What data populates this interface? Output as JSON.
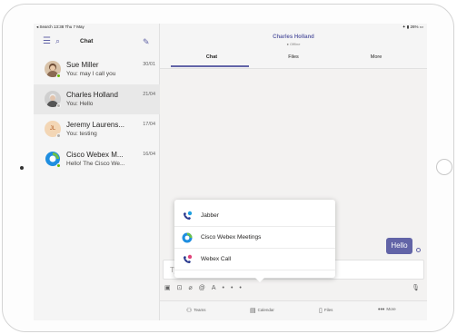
{
  "status_bar": {
    "left": "◂ Search  13:38  Thu 7 May",
    "right": "✦ ▮ 26% ▭"
  },
  "sidebar": {
    "title": "Chat",
    "chats": [
      {
        "name": "Sue Miller",
        "date": "30/01",
        "preview": "You: may I call you",
        "status": "available"
      },
      {
        "name": "Charles Holland",
        "date": "21/04",
        "preview": "You: Hello",
        "status": "offline"
      },
      {
        "name": "Jeremy Laurens...",
        "date": "17/04",
        "preview": "You: testing",
        "initials": "JL",
        "status": "offline"
      },
      {
        "name": "Cisco Webex M...",
        "date": "16/04",
        "preview": "Hello! The Cisco We...",
        "status": "available"
      }
    ]
  },
  "conversation": {
    "contact_name": "Charles Holland",
    "contact_status": "Offline",
    "tabs": [
      "Chat",
      "Files",
      "More"
    ],
    "messages": [
      {
        "text": "Hello",
        "sender": "me"
      }
    ],
    "compose_placeholder": "Ty"
  },
  "app_picker": {
    "items": [
      {
        "label": "Jabber",
        "icon": "jabber-icon"
      },
      {
        "label": "Cisco Webex Meetings",
        "icon": "webex-meetings-icon"
      },
      {
        "label": "Webex Call",
        "icon": "webex-call-icon"
      }
    ]
  },
  "bottom_nav": [
    {
      "label": "Teams",
      "icon": "teams-icon"
    },
    {
      "label": "Calendar",
      "icon": "calendar-icon"
    },
    {
      "label": "Files",
      "icon": "files-icon"
    },
    {
      "label": "More",
      "icon": "more-icon"
    }
  ],
  "colors": {
    "accent": "#6264a7",
    "available": "#6bb700",
    "offline": "#b3b0ad"
  }
}
